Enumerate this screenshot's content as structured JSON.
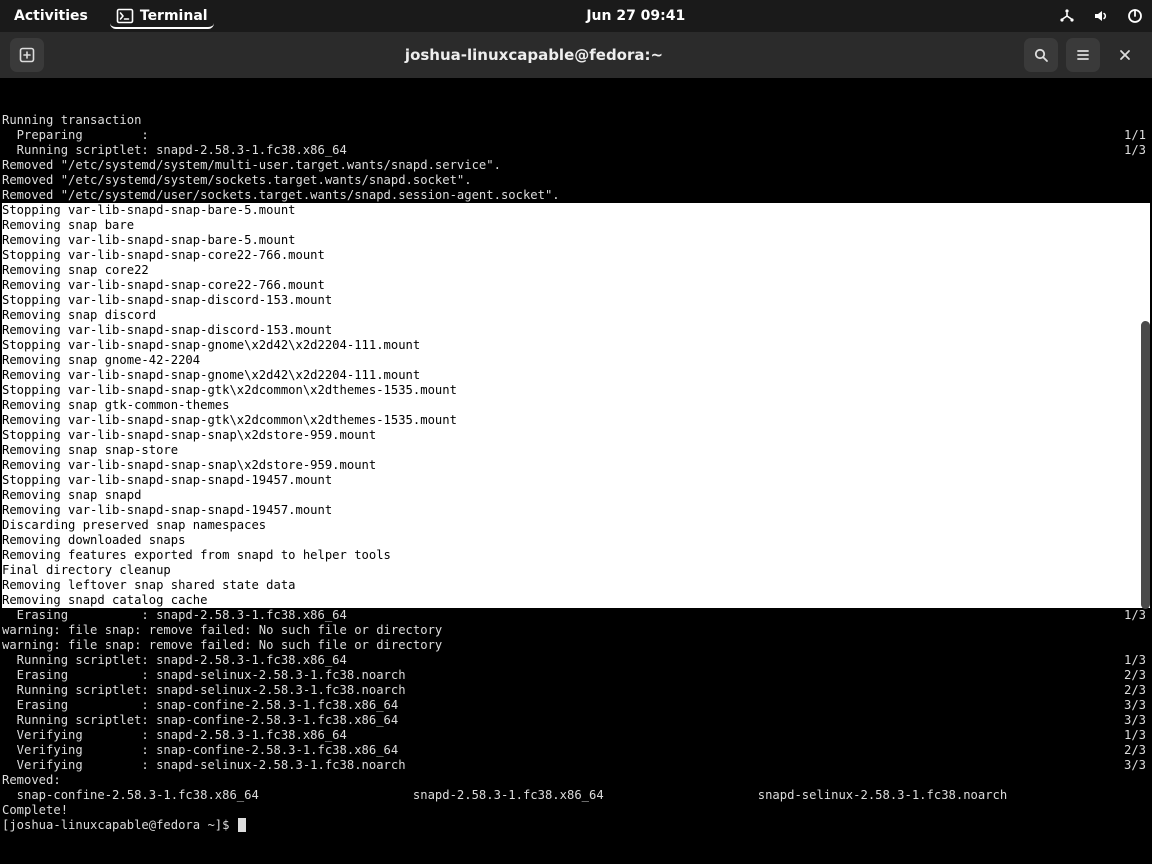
{
  "topbar": {
    "activities": "Activities",
    "terminal": "Terminal",
    "clock": "Jun 27  09:41"
  },
  "window": {
    "title": "joshua-linuxcapable@fedora:~"
  },
  "term": {
    "pre": [
      {
        "l": "Running transaction"
      },
      {
        "l": "  Preparing        :",
        "r": "1/1"
      },
      {
        "l": "  Running scriptlet: snapd-2.58.3-1.fc38.x86_64",
        "r": "1/3"
      },
      {
        "l": "Removed \"/etc/systemd/system/multi-user.target.wants/snapd.service\"."
      },
      {
        "l": "Removed \"/etc/systemd/system/sockets.target.wants/snapd.socket\"."
      },
      {
        "l": "Removed \"/etc/systemd/user/sockets.target.wants/snapd.session-agent.socket\"."
      }
    ],
    "inv_first_char": "S",
    "inv_first_rest": "topping var-lib-snapd-snap-bare-5.mount",
    "inv": [
      "Removing snap bare",
      "Removing var-lib-snapd-snap-bare-5.mount",
      "Stopping var-lib-snapd-snap-core22-766.mount",
      "Removing snap core22",
      "Removing var-lib-snapd-snap-core22-766.mount",
      "Stopping var-lib-snapd-snap-discord-153.mount",
      "Removing snap discord",
      "Removing var-lib-snapd-snap-discord-153.mount",
      "Stopping var-lib-snapd-snap-gnome\\x2d42\\x2d2204-111.mount",
      "Removing snap gnome-42-2204",
      "Removing var-lib-snapd-snap-gnome\\x2d42\\x2d2204-111.mount",
      "Stopping var-lib-snapd-snap-gtk\\x2dcommon\\x2dthemes-1535.mount",
      "Removing snap gtk-common-themes",
      "Removing var-lib-snapd-snap-gtk\\x2dcommon\\x2dthemes-1535.mount",
      "Stopping var-lib-snapd-snap-snap\\x2dstore-959.mount",
      "Removing snap snap-store",
      "Removing var-lib-snapd-snap-snap\\x2dstore-959.mount",
      "Stopping var-lib-snapd-snap-snapd-19457.mount",
      "Removing snap snapd",
      "Removing var-lib-snapd-snap-snapd-19457.mount",
      "Discarding preserved snap namespaces",
      "Removing downloaded snaps",
      "Removing features exported from snapd to helper tools",
      "Final directory cleanup",
      "Removing leftover snap shared state data",
      "Removing snapd catalog cache"
    ],
    "post": [
      {
        "l": ""
      },
      {
        "l": "  Erasing          : snapd-2.58.3-1.fc38.x86_64",
        "r": "1/3"
      },
      {
        "l": "warning: file snap: remove failed: No such file or directory"
      },
      {
        "l": "warning: file snap: remove failed: No such file or directory"
      },
      {
        "l": ""
      },
      {
        "l": "  Running scriptlet: snapd-2.58.3-1.fc38.x86_64",
        "r": "1/3"
      },
      {
        "l": "  Erasing          : snapd-selinux-2.58.3-1.fc38.noarch",
        "r": "2/3"
      },
      {
        "l": "  Running scriptlet: snapd-selinux-2.58.3-1.fc38.noarch",
        "r": "2/3"
      },
      {
        "l": "  Erasing          : snap-confine-2.58.3-1.fc38.x86_64",
        "r": "3/3"
      },
      {
        "l": "  Running scriptlet: snap-confine-2.58.3-1.fc38.x86_64",
        "r": "3/3"
      },
      {
        "l": "  Verifying        : snapd-2.58.3-1.fc38.x86_64",
        "r": "1/3"
      },
      {
        "l": "  Verifying        : snap-confine-2.58.3-1.fc38.x86_64",
        "r": "2/3"
      },
      {
        "l": "  Verifying        : snapd-selinux-2.58.3-1.fc38.noarch",
        "r": "3/3"
      },
      {
        "l": ""
      },
      {
        "l": "Removed:"
      },
      {
        "l": "  snap-confine-2.58.3-1.fc38.x86_64                     snapd-2.58.3-1.fc38.x86_64                     snapd-selinux-2.58.3-1.fc38.noarch"
      },
      {
        "l": ""
      },
      {
        "l": "Complete!"
      }
    ],
    "prompt": "[joshua-linuxcapable@fedora ~]$ "
  }
}
